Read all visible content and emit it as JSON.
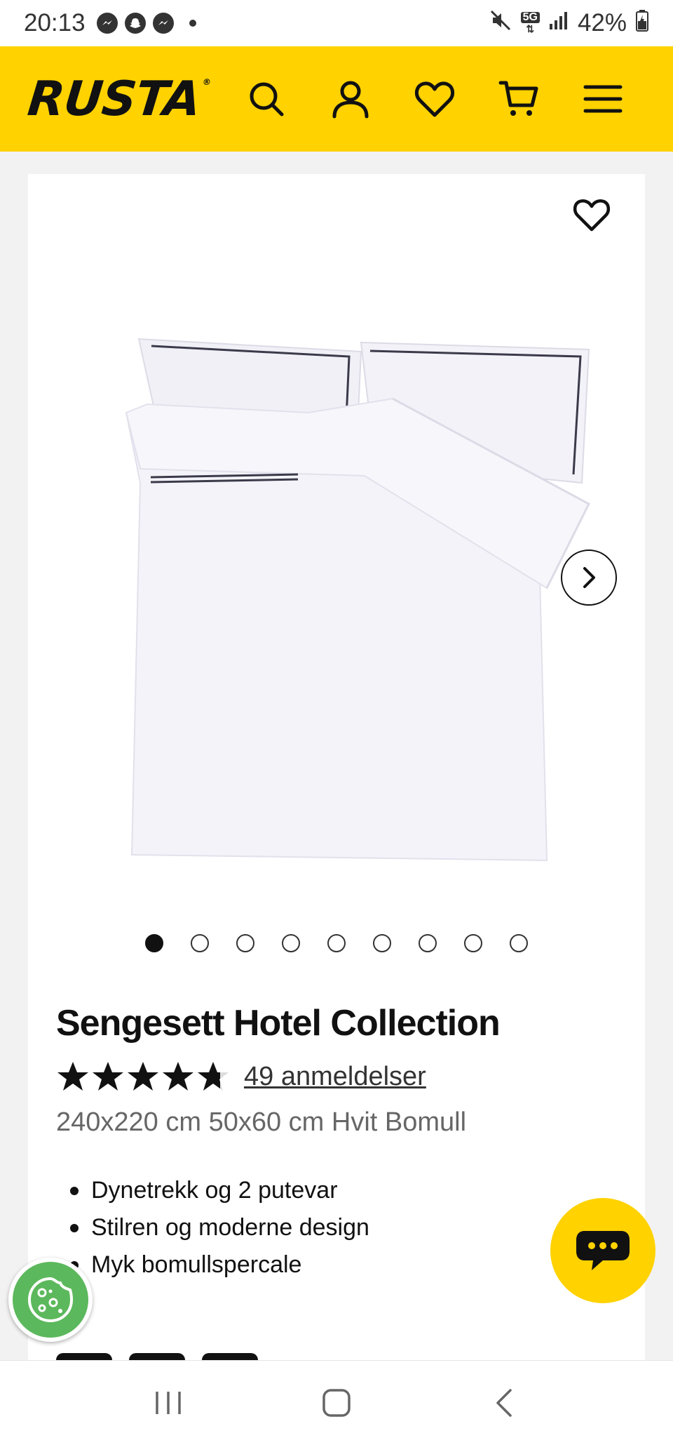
{
  "status_bar": {
    "time": "20:13",
    "network": "5G",
    "battery": "42%",
    "icons": [
      "messenger-icon",
      "snapchat-icon",
      "messenger-icon",
      "mute-icon",
      "signal-icon",
      "battery-icon"
    ]
  },
  "header": {
    "logo": "RUSTA",
    "logo_mark": "®",
    "background_color": "#ffd200",
    "icons": [
      "search-icon",
      "account-icon",
      "favorites-icon",
      "cart-icon",
      "menu-icon"
    ]
  },
  "product": {
    "title": "Sengesett Hotel Collection",
    "rating": 4.7,
    "rating_max": 5,
    "reviews_link": "49 anmeldelser",
    "variant": "240x220 cm 50x60 cm Hvit Bomull",
    "image_alt": "white bedding set with duvet cover and two pillowcases",
    "image_count": 9,
    "active_image": 1,
    "features": [
      "Dynetrekk og 2 putevar",
      "Stilren og moderne design",
      "Myk bomullspercale"
    ]
  },
  "colors": {
    "brand_yellow": "#ffd200",
    "cookie_green": "#5cb85c"
  }
}
